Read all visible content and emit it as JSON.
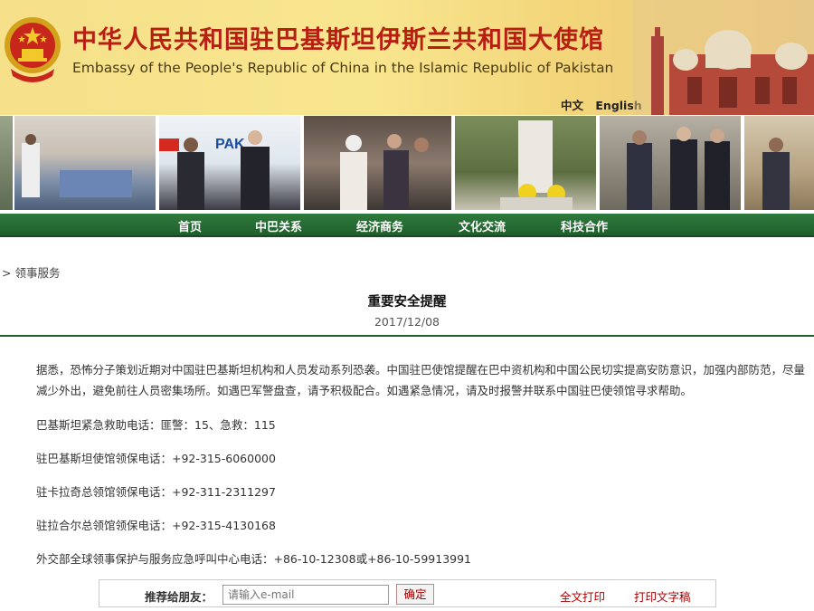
{
  "header": {
    "title_cn": "中华人民共和国驻巴基斯坦伊斯兰共和国大使馆",
    "title_en": "Embassy of the People's Republic of China in the Islamic Republic of Pakistan",
    "lang_cn": "中文",
    "lang_en": "English"
  },
  "nav": {
    "items": [
      {
        "label": "首页"
      },
      {
        "label": "中巴关系"
      },
      {
        "label": "经济商务"
      },
      {
        "label": "文化交流"
      },
      {
        "label": "科技合作"
      }
    ]
  },
  "breadcrumb": "> 领事服务",
  "article": {
    "title": "重要安全提醒",
    "date": "2017/12/08",
    "paragraph": "据悉，恐怖分子策划近期对中国驻巴基斯坦机构和人员发动系列恐袭。中国驻巴使馆提醒在巴中资机构和中国公民切实提高安防意识，加强内部防范，尽量减少外出，避免前往人员密集场所。如遇巴军警盘查，请予积极配合。如遇紧急情况，请及时报警并联系中国驻巴使领馆寻求帮助。",
    "lines": [
      "巴基斯坦紧急救助电话：匪警：15、急救：115",
      "驻巴基斯坦使馆领保电话：+92-315-6060000",
      "驻卡拉奇总领馆领保电话：+92-311-2311297",
      "驻拉合尔总领馆领保电话：+92-315-4130168",
      "外交部全球领事保护与服务应急呼叫中心电话：+86-10-12308或+86-10-59913991"
    ]
  },
  "share": {
    "label": "推荐给朋友：",
    "placeholder": "请输入e-mail",
    "confirm": "确定",
    "print_full": "全文打印",
    "print_text": "打印文字稿"
  },
  "colors": {
    "nav_green": "#1f5e2b",
    "title_red": "#b81f13",
    "banner_yellow": "#f6e08a"
  }
}
